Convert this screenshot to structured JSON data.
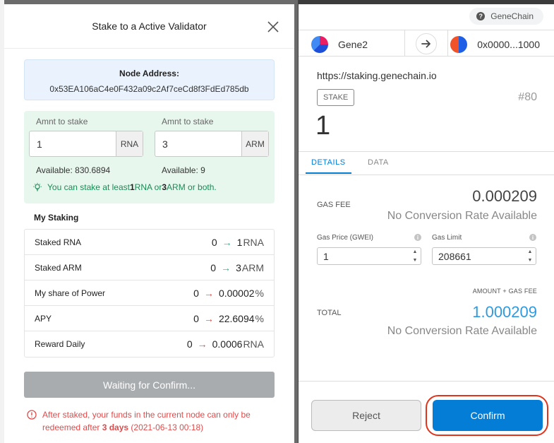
{
  "stake_modal": {
    "title": "Stake to a Active Validator",
    "node_address_label": "Node Address:",
    "node_address": "0x53EA106aC4e0F432a09c2Af7ceCd8f3FdEd785db",
    "rna_field": {
      "label": "Amnt to stake",
      "value": "1",
      "unit": "RNA",
      "available": "Available: 830.6894"
    },
    "arm_field": {
      "label": "Amnt to stake",
      "value": "3",
      "unit": "ARM",
      "available": "Available: 9"
    },
    "hint": {
      "prefix": "You can stake at least ",
      "rna_min": "1",
      "rna_unit": " RNA or ",
      "arm_min": "3",
      "arm_unit": " ARM or both."
    },
    "my_staking_title": "My Staking",
    "rows": [
      {
        "label": "Staked RNA",
        "from": "0",
        "to": "1",
        "unit": "RNA",
        "arrow": "green"
      },
      {
        "label": "Staked ARM",
        "from": "0",
        "to": "3",
        "unit": "ARM",
        "arrow": "green"
      },
      {
        "label": "My share of Power",
        "from": "0",
        "to": "0.00002",
        "unit": "%",
        "arrow": "red"
      },
      {
        "label": "APY",
        "from": "0",
        "to": "22.6094",
        "unit": "%",
        "arrow": "red"
      },
      {
        "label": "Reward Daily",
        "from": "0",
        "to": "0.0006",
        "unit": "RNA",
        "arrow": "red"
      }
    ],
    "waiting_button": "Waiting for Confirm...",
    "warning": {
      "text1": "After staked, your funds in the current node can only be redeemed after ",
      "days": "3 days",
      "date": " (2021-06-13 00:18)"
    }
  },
  "wallet": {
    "network": "GeneChain",
    "network_icon_glyph": "?",
    "from_account": "Gene2",
    "to_account": "0x0000...1000",
    "origin": "https://staking.genechain.io",
    "method": "STAKE",
    "nonce": "#80",
    "amount": "1",
    "tabs": [
      "DETAILS",
      "DATA"
    ],
    "gas_fee_label": "GAS FEE",
    "gas_fee": "0.000209",
    "no_conversion": "No Conversion Rate Available",
    "gas_price_label": "Gas Price (GWEI)",
    "gas_price": "1",
    "gas_limit_label": "Gas Limit",
    "gas_limit": "208661",
    "info_glyph": "i",
    "amount_gas_label": "AMOUNT + GAS FEE",
    "total_label": "TOTAL",
    "total": "1.000209",
    "reject": "Reject",
    "confirm": "Confirm"
  },
  "colors": {
    "accent": "#037dd6",
    "success": "#2eb285",
    "danger": "#e24a4a",
    "highlight_ring": "#e0341c"
  }
}
